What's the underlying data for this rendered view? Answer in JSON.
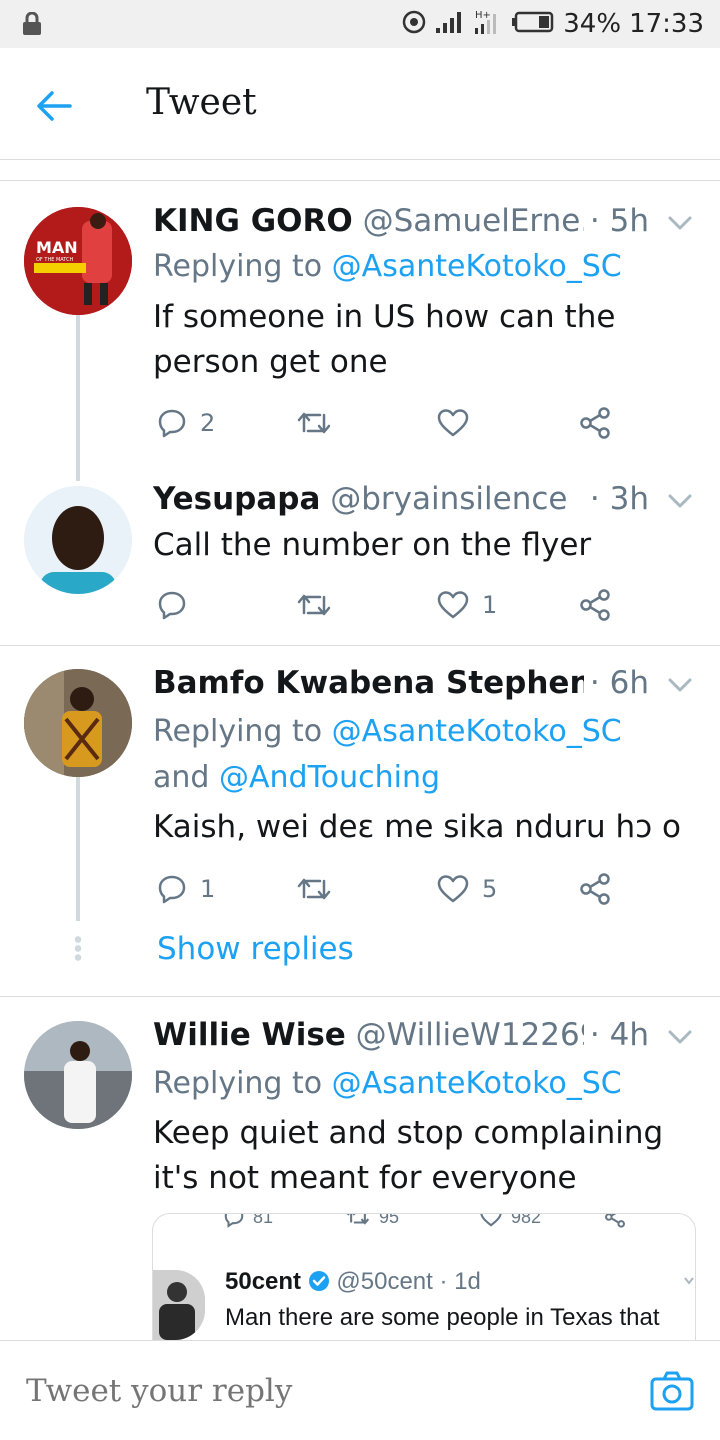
{
  "status_bar": {
    "battery": "34%",
    "time": "17:33"
  },
  "header": {
    "title": "Tweet"
  },
  "tweets": [
    {
      "name": "KING GORO",
      "handle": "@SamuelErne...",
      "time": "· 5h",
      "reply_prefix": "Replying to ",
      "reply_to": "@AsanteKotoko_SC",
      "text": "If someone in US how can the person get one",
      "replies": "2",
      "retweets": "",
      "likes": "",
      "avatar_text": "MAN",
      "avatar_subtext": "OF THE MATCH"
    },
    {
      "name": "Yesupapa",
      "handle": "@bryainsilence",
      "time": "· 3h",
      "text": "Call the number on the flyer",
      "replies": "",
      "retweets": "",
      "likes": "1"
    },
    {
      "name": "Bamfo Kwabena Stephen ...",
      "handle": "",
      "time": "· 6h",
      "reply_prefix": "Replying to ",
      "reply_to": "@AsanteKotoko_SC",
      "reply_and": "and ",
      "reply_to_2": "@AndTouching",
      "text": "Kaish, wei deɛ me sika nduru hɔ o",
      "replies": "1",
      "retweets": "",
      "likes": "5",
      "show_replies": "Show replies"
    },
    {
      "name": "Willie Wise",
      "handle": "@WillieW12269...",
      "time": "· 4h",
      "reply_prefix": "Replying to ",
      "reply_to": "@AsanteKotoko_SC",
      "text": "Keep quiet and stop complaining it's not meant for everyone",
      "embed": {
        "stat_replies": "81",
        "stat_retweets": "95",
        "stat_likes": "982",
        "name": "50cent",
        "handle": "@50cent · 1d",
        "text": "Man there are some people in Texas that"
      }
    }
  ],
  "composer": {
    "placeholder": "Tweet your reply"
  },
  "colors": {
    "accent": "#1da1f2",
    "secondary_text": "#657786",
    "divider": "#dcdcdc"
  }
}
